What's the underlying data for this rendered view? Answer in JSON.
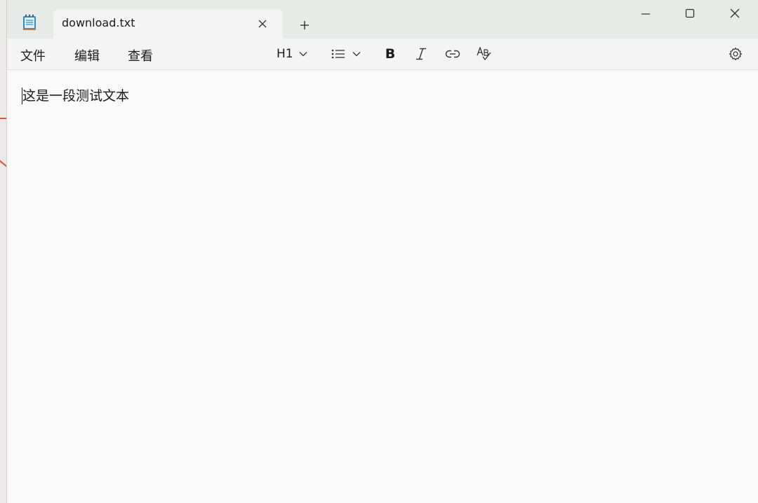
{
  "tab": {
    "title": "download.txt",
    "close_icon": "close-icon",
    "new_tab_icon": "plus-icon"
  },
  "window_controls": {
    "minimize_icon": "minimize-icon",
    "maximize_icon": "maximize-icon",
    "close_icon": "close-icon"
  },
  "menu": {
    "file": "文件",
    "edit": "编辑",
    "view": "查看"
  },
  "toolbar": {
    "heading": "H1",
    "bold": "B",
    "icons": [
      "chevron-down-icon",
      "bullet-list-icon",
      "italic-icon",
      "link-icon",
      "spellcheck-icon",
      "gear-icon"
    ]
  },
  "editor": {
    "content": "这是一段测试文本"
  },
  "colors": {
    "titlebar": "#e7ebe8",
    "tab_bg": "#f3f4f3",
    "editor_bg": "#f9f9f9",
    "app_icon_accent": "#2a8fd6"
  }
}
